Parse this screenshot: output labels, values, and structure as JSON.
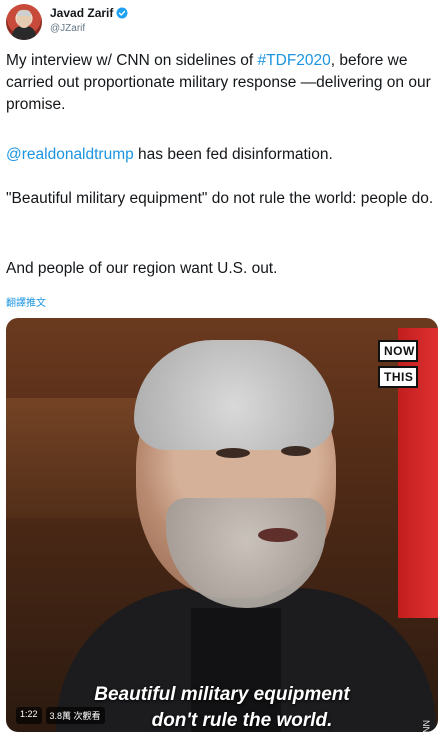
{
  "author": {
    "display_name": "Javad Zarif",
    "handle": "@JZarif",
    "verified_color": "#1da1f2"
  },
  "tweet": {
    "paragraphs": [
      {
        "parts": [
          {
            "text": "My interview w/ CNN on sidelines of ",
            "link": false
          },
          {
            "text": "#TDF2020",
            "link": true
          },
          {
            "text": ", before we carried out proportionate military response —delivering on our promise.",
            "link": false
          }
        ]
      },
      {
        "parts": [
          {
            "text": "@realdonaldtrump",
            "link": true
          },
          {
            "text": " has been fed disinformation.",
            "link": false
          }
        ]
      },
      {
        "parts": [
          {
            "text": "\"Beautiful military equipment\" do not rule the world: people do.",
            "link": false
          }
        ]
      },
      {
        "parts": [
          {
            "text": "And people of our region want U.S. out.",
            "link": false
          }
        ]
      }
    ],
    "translate_label": "翻譯推文",
    "link_color": "#1b95e0"
  },
  "video": {
    "brand_line1": "NOW",
    "brand_line2": "THIS",
    "caption_line1": "Beautiful military equipment",
    "caption_line2": "don't rule the world.",
    "duration": "1:22",
    "views": "3.8萬 次觀看",
    "source_watermark": "© CNN"
  }
}
